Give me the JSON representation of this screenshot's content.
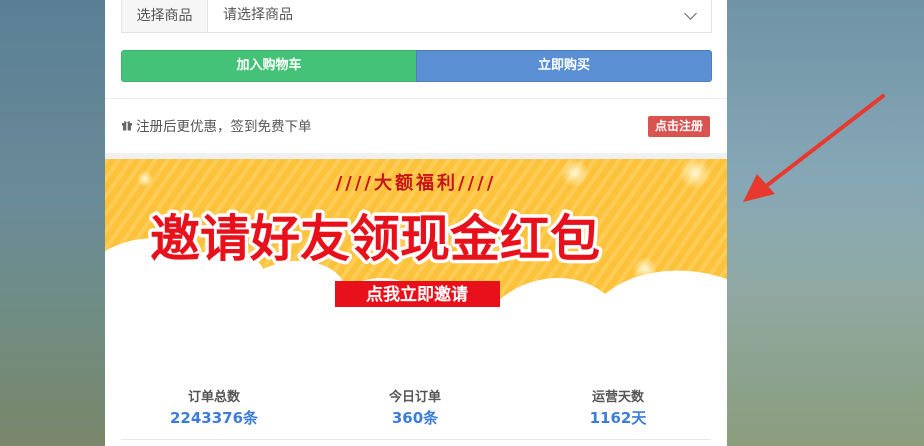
{
  "product_select": {
    "addon_label": "选择商品",
    "selected_value": "请选择商品"
  },
  "actions": {
    "add_to_cart": "加入购物车",
    "buy_now": "立即购买"
  },
  "notice": {
    "text": "注册后更优惠，签到免费下单",
    "register_button": "点击注册"
  },
  "banner": {
    "tagline": "////大额福利////",
    "headline": "邀请好友领现金红包",
    "cta": "点我立即邀请",
    "colors": {
      "background": "#fcc23b",
      "headline": "#e8111b",
      "cta_bg": "#e8111b",
      "tagline": "#c8131a"
    }
  },
  "stats": [
    {
      "label": "订单总数",
      "value": "2243376条"
    },
    {
      "label": "今日订单",
      "value": "360条"
    },
    {
      "label": "运营天数",
      "value": "1162天"
    }
  ],
  "icons": {
    "gift": "gift-icon",
    "chevron": "chevron-down-icon",
    "arrow": "red-arrow-annotation"
  }
}
